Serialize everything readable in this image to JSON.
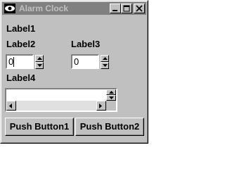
{
  "window": {
    "title": "Alarm Clock"
  },
  "labels": {
    "label1": "Label1",
    "label2": "Label2",
    "label3": "Label3",
    "label4": "Label4"
  },
  "spinners": {
    "spin1": {
      "value": "0"
    },
    "spin2": {
      "value": "0"
    }
  },
  "buttons": {
    "push1": "Push Button1",
    "push2": "Push Button2"
  },
  "icons": {
    "app": "eye-icon",
    "minimize": "minimize-icon",
    "maximize": "maximize-icon",
    "close": "close-icon"
  }
}
